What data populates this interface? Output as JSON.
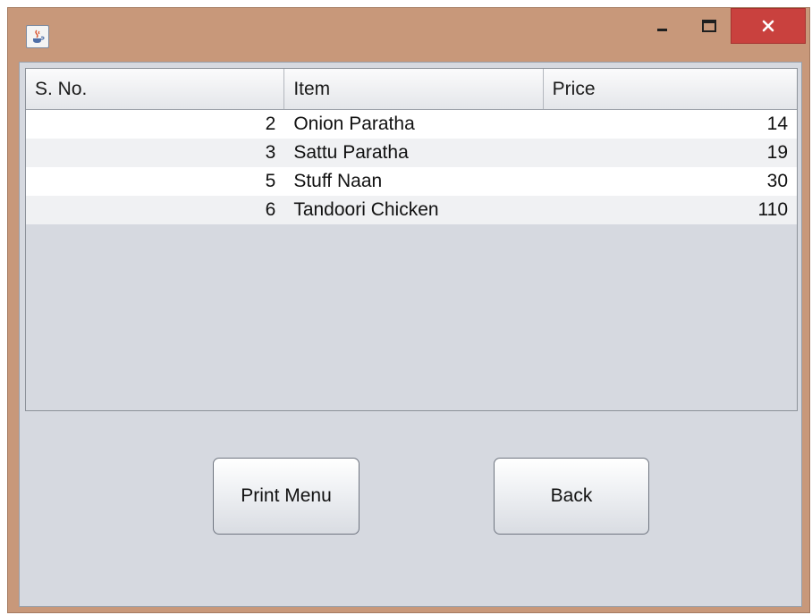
{
  "titlebar": {
    "icon": "java-cup-icon",
    "controls": {
      "minimize": "minimize-icon",
      "maximize": "maximize-icon",
      "close": "close-icon"
    }
  },
  "table": {
    "headers": {
      "sno": "S. No.",
      "item": "Item",
      "price": "Price"
    },
    "rows": [
      {
        "sno": "2",
        "item": "Onion Paratha",
        "price": "14"
      },
      {
        "sno": "3",
        "item": "Sattu Paratha",
        "price": "19"
      },
      {
        "sno": "5",
        "item": "Stuff Naan",
        "price": "30"
      },
      {
        "sno": "6",
        "item": "Tandoori Chicken",
        "price": "110"
      }
    ]
  },
  "buttons": {
    "print_label": "Print Menu",
    "back_label": "Back"
  },
  "colors": {
    "frame": "#c8987a",
    "close": "#c9413e",
    "panel": "#d6d9e0"
  }
}
